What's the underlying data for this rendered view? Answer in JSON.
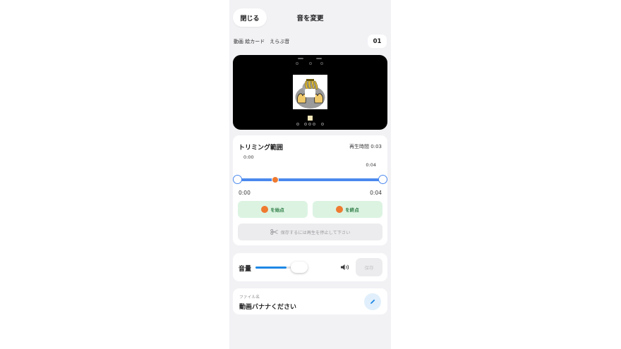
{
  "header": {
    "close_label": "閉じる",
    "title": "音を変更"
  },
  "subheader": {
    "breadcrumb": "動画 絵カード　えらぶ音",
    "number": "01"
  },
  "trim": {
    "title": "トリミング範囲",
    "play_time": "再生時間 0:03",
    "start_top": "0:00",
    "end_top": "0:04",
    "start_bottom": "0:00",
    "end_bottom": "0:04",
    "set_start_label": "を始点",
    "set_end_label": "を終点",
    "trim_button_label": "保存するには再生を停止して下さい",
    "playhead_fraction": 0.25
  },
  "volume": {
    "label": "音量",
    "level_fraction": 0.65,
    "save_label": "保存"
  },
  "file": {
    "label": "ファイル名",
    "name": "動画バナナください"
  },
  "colors": {
    "accent_blue": "#4a88ee",
    "playhead_orange": "#ef7a2f",
    "mark_button_bg": "#dcf3e2",
    "mark_button_text": "#2e7d45",
    "background": "#f2f2f5"
  }
}
